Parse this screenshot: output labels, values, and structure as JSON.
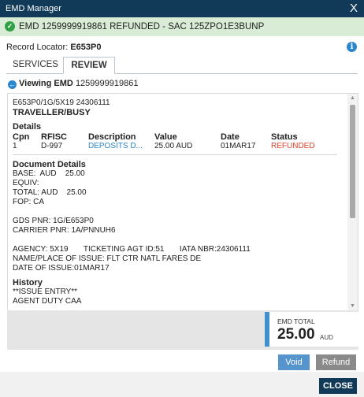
{
  "window": {
    "title": "EMD Manager",
    "close_glyph": "X"
  },
  "banner": {
    "message": "EMD 1259999919861 REFUNDED - SAC 125ZPO1E3BUNP",
    "icon": "check-circle-icon",
    "color": "#d8ecd6"
  },
  "record": {
    "label": "Record Locator: ",
    "value": "E653P0"
  },
  "tabs": [
    {
      "label": "SERVICES"
    },
    {
      "label": "REVIEW"
    }
  ],
  "viewing": {
    "label": "Viewing EMD",
    "number": "1259999919861"
  },
  "document": {
    "line1": "E653P0/1G/5X19 24306111",
    "passenger": "TRAVELLER/BUSY",
    "details_title": "Details",
    "columns": [
      "Cpn",
      "RFISC",
      "Description",
      "Value",
      "Date",
      "Status"
    ],
    "rows": [
      {
        "cpn": "1",
        "rfisc": "D-997",
        "description": "DEPOSITS D...",
        "value": "25.00 AUD",
        "date": "01MAR17",
        "status": "REFUNDED"
      }
    ],
    "doc_details_title": "Document Details",
    "base": "BASE:  AUD    25.00",
    "equiv": "EQUIV:",
    "total": "TOTAL: AUD    25.00",
    "fop": "FOP: CA",
    "gds_pnr": "GDS PNR: 1G/E653P0",
    "carrier_pnr": "CARRIER PNR: 1A/PNNUH6",
    "agency": "AGENCY: 5X19       TICKETING AGT ID:51       IATA NBR:24306111",
    "place_of_issue": "NAME/PLACE OF ISSUE: FLT CTR NATL FARES DE",
    "date_of_issue": "DATE OF ISSUE:01MAR17",
    "history_title": "History",
    "history_line1": "**ISSUE ENTRY**",
    "history_line2": "AGENT DUTY CAA"
  },
  "total": {
    "label": "EMD TOTAL",
    "amount": "25.00",
    "currency": "AUD"
  },
  "buttons": {
    "void": "Void",
    "refund": "Refund",
    "close": "CLOSE"
  },
  "colors": {
    "titlebar": "#103a58",
    "accent": "#3f90cc",
    "refunded": "#e0422b"
  }
}
